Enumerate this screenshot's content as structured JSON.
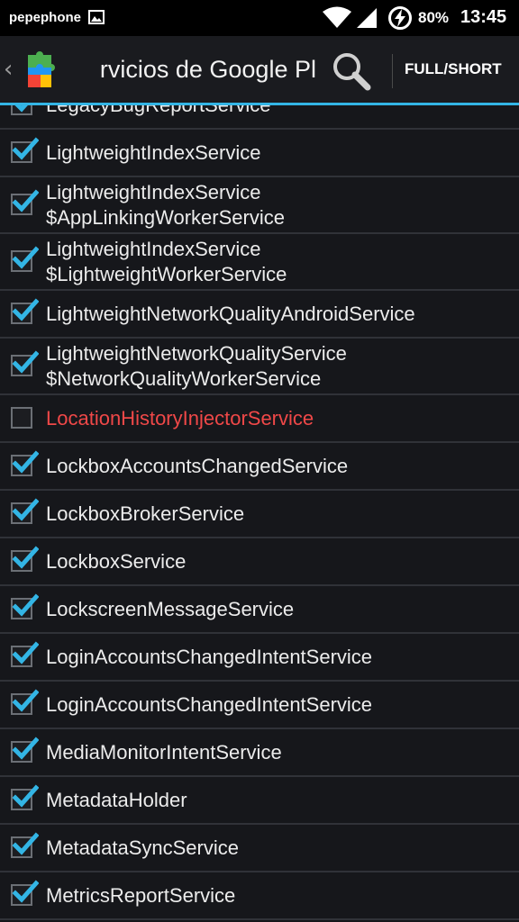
{
  "status_bar": {
    "carrier": "pepephone",
    "battery": "80%",
    "time": "13:45"
  },
  "action_bar": {
    "title": "rvicios de Google Pla",
    "toggle_label": "FULL/SHORT"
  },
  "colors": {
    "accent": "#33b5e5",
    "disabled_text": "#f04848",
    "check": "#33b5e5"
  },
  "services": [
    {
      "line1": "LegacyBugReportService",
      "line2": "",
      "checked": true
    },
    {
      "line1": "LightweightIndexService",
      "line2": "",
      "checked": true
    },
    {
      "line1": "LightweightIndexService",
      "line2": "$AppLinkingWorkerService",
      "checked": true
    },
    {
      "line1": "LightweightIndexService",
      "line2": "$LightweightWorkerService",
      "checked": true
    },
    {
      "line1": "LightweightNetworkQualityAndroidService",
      "line2": "",
      "checked": true
    },
    {
      "line1": "LightweightNetworkQualityService",
      "line2": "$NetworkQualityWorkerService",
      "checked": true
    },
    {
      "line1": "LocationHistoryInjectorService",
      "line2": "",
      "checked": false
    },
    {
      "line1": "LockboxAccountsChangedService",
      "line2": "",
      "checked": true
    },
    {
      "line1": "LockboxBrokerService",
      "line2": "",
      "checked": true
    },
    {
      "line1": "LockboxService",
      "line2": "",
      "checked": true
    },
    {
      "line1": "LockscreenMessageService",
      "line2": "",
      "checked": true
    },
    {
      "line1": "LoginAccountsChangedIntentService",
      "line2": "",
      "checked": true
    },
    {
      "line1": "LoginAccountsChangedIntentService",
      "line2": "",
      "checked": true
    },
    {
      "line1": "MediaMonitorIntentService",
      "line2": "",
      "checked": true
    },
    {
      "line1": "MetadataHolder",
      "line2": "",
      "checked": true
    },
    {
      "line1": "MetadataSyncService",
      "line2": "",
      "checked": true
    },
    {
      "line1": "MetricsReportService",
      "line2": "",
      "checked": true
    }
  ]
}
